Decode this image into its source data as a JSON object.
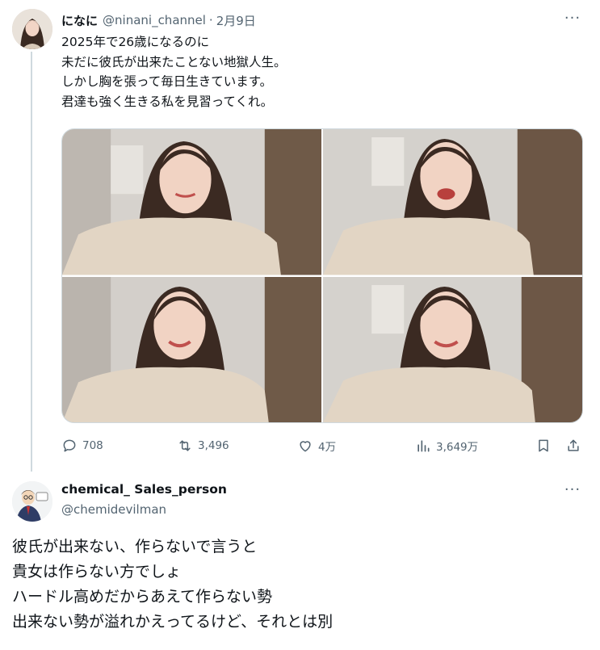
{
  "post": {
    "display_name": "になに",
    "handle": "@ninani_channel",
    "separator": "·",
    "date": "2月9日",
    "more_label": "···",
    "text_lines": [
      "2025年で26歳になるのに",
      "未だに彼氏が出来たことない地獄人生。",
      "しかし胸を張って毎日生きています。",
      "君達も強く生きる私を見習ってくれ。"
    ],
    "photos": [
      {
        "name": "photo-1-smile-closed"
      },
      {
        "name": "photo-2-open-smile"
      },
      {
        "name": "photo-3-wink"
      },
      {
        "name": "photo-4-smile"
      }
    ],
    "actions": {
      "replies": "708",
      "reposts": "3,496",
      "likes": "4万",
      "views": "3,649万"
    }
  },
  "reply": {
    "display_name": "chemical_ Sales_person",
    "handle": "@chemidevilman",
    "more_label": "···",
    "text_lines": [
      "彼氏が出来ない、作らないで言うと",
      "貴女は作らない方でしょ",
      "ハードル高めだからあえて作らない勢",
      "出来ない勢が溢れかえってるけど、それとは別"
    ]
  },
  "colors": {
    "text_primary": "#0f1419",
    "text_secondary": "#536471",
    "border": "#cfd9de"
  },
  "icons": [
    "reply-icon",
    "repost-icon",
    "like-icon",
    "views-icon",
    "bookmark-icon",
    "share-icon",
    "more-icon"
  ]
}
